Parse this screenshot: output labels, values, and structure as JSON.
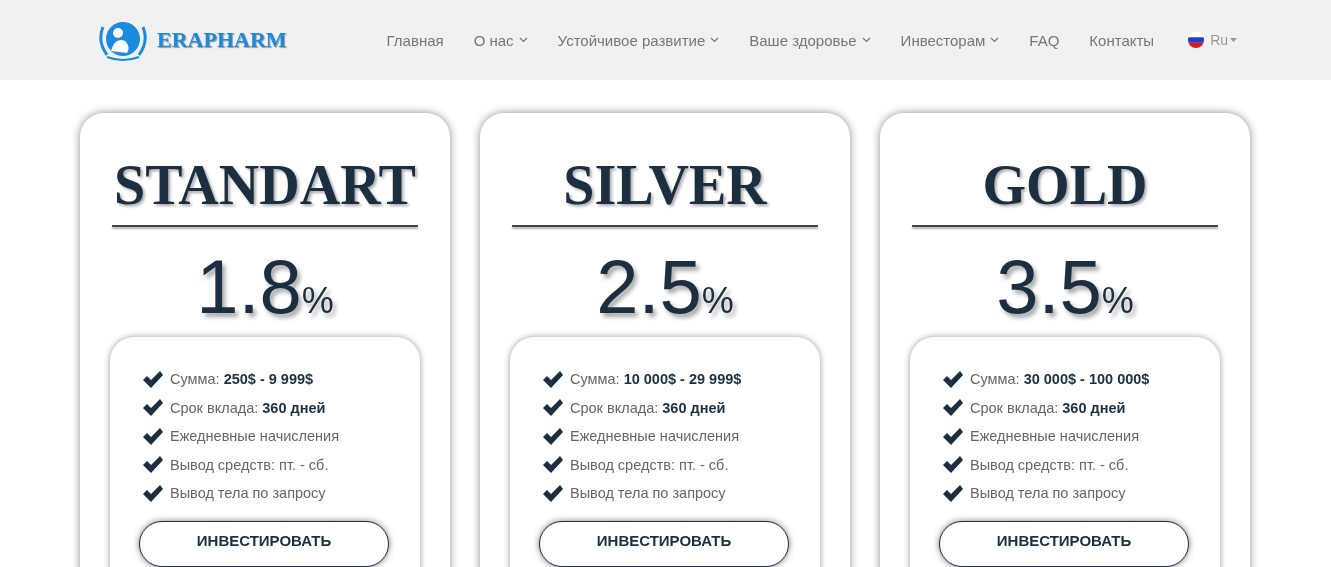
{
  "header": {
    "logo_text": "ERAPHARM",
    "nav": [
      {
        "label": "Главная",
        "dropdown": false
      },
      {
        "label": "О нас",
        "dropdown": true
      },
      {
        "label": "Устойчивое развитие",
        "dropdown": true
      },
      {
        "label": "Ваше здоровье",
        "dropdown": true
      },
      {
        "label": "Инвесторам",
        "dropdown": true
      },
      {
        "label": "FAQ",
        "dropdown": false
      },
      {
        "label": "Контакты",
        "dropdown": false
      }
    ],
    "language": "Ru"
  },
  "plans": [
    {
      "name": "STANDART",
      "rate": "1.8",
      "unit": "%",
      "features": [
        "Сумма: **250$ - 9 999$**",
        "Срок вклада: **360 дней**",
        "Ежедневные начисления",
        "Вывод средств: пт. - сб.",
        "Вывод тела по запросу"
      ],
      "button": "ИНВЕСТИРОВАТЬ"
    },
    {
      "name": "SILVER",
      "rate": "2.5",
      "unit": "%",
      "features": [
        "Сумма: **10 000$ - 29 999$**",
        "Срок вклада: **360 дней**",
        "Ежедневные начисления",
        "Вывод средств: пт. - сб.",
        "Вывод тела по запросу"
      ],
      "button": "ИНВЕСТИРОВАТЬ"
    },
    {
      "name": "GOLD",
      "rate": "3.5",
      "unit": "%",
      "features": [
        "Сумма: **30 000$ - 100 000$**",
        "Срок вклада: **360 дней**",
        "Ежедневные начисления",
        "Вывод средств: пт. - сб.",
        "Вывод тела по запросу"
      ],
      "button": "ИНВЕСТИРОВАТЬ"
    }
  ]
}
